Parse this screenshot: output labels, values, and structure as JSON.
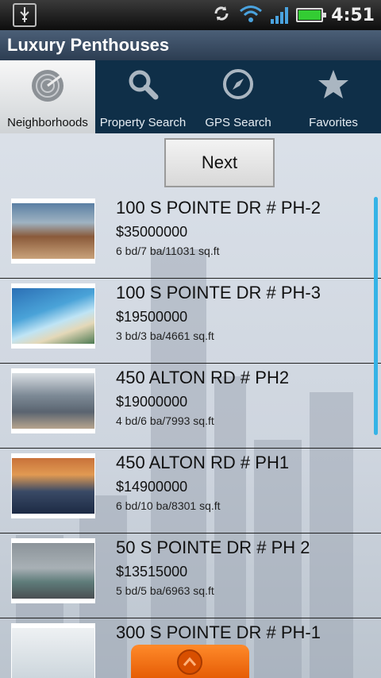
{
  "status_bar": {
    "time": "4:51",
    "battery_level": 1.0
  },
  "app": {
    "title": "Luxury Penthouses"
  },
  "tabs": [
    {
      "label": "Neighborhoods",
      "icon": "radar-icon",
      "active": true
    },
    {
      "label": "Property Search",
      "icon": "search-icon",
      "active": false
    },
    {
      "label": "GPS Search",
      "icon": "compass-icon",
      "active": false
    },
    {
      "label": "Favorites",
      "icon": "star-icon",
      "active": false
    }
  ],
  "next_label": "Next",
  "listings": [
    {
      "address": "100 S POINTE DR # PH-2",
      "price": "$35000000",
      "specs": "6 bd/7 ba/11031 sq.ft"
    },
    {
      "address": "100 S POINTE DR # PH-3",
      "price": "$19500000",
      "specs": "3 bd/3 ba/4661 sq.ft"
    },
    {
      "address": "450 ALTON RD # PH2",
      "price": "$19000000",
      "specs": "4 bd/6 ba/7993 sq.ft"
    },
    {
      "address": "450 ALTON RD # PH1",
      "price": "$14900000",
      "specs": "6 bd/10 ba/8301 sq.ft"
    },
    {
      "address": "50 S POINTE DR # PH 2",
      "price": "$13515000",
      "specs": "5 bd/5 ba/6963 sq.ft"
    },
    {
      "address": "300 S POINTE DR # PH-1",
      "price": "",
      "specs": ""
    }
  ],
  "colors": {
    "accent": "#35b3e6",
    "handle": "#f07414",
    "tab_bar": "#0f2f48"
  }
}
